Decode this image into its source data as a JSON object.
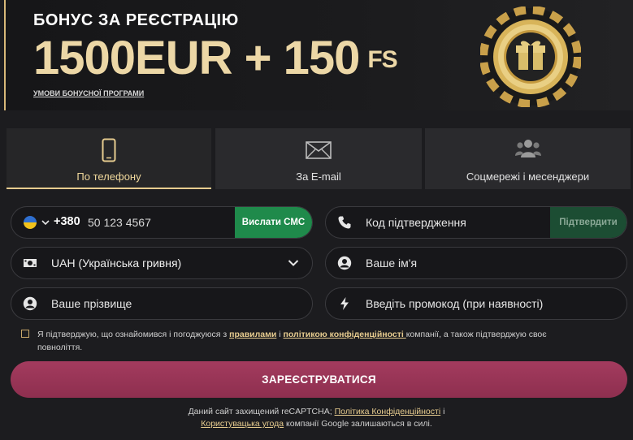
{
  "banner": {
    "title": "БОНУС ЗА РЕЄСТРАЦІЮ",
    "amount": "1500EUR + 150",
    "amount_suffix": "FS",
    "terms_link": "УМОВИ БОНУСНОЇ ПРОГРАМИ"
  },
  "tabs": [
    {
      "label": "По телефону",
      "icon": "phone-icon",
      "active": true
    },
    {
      "label": "За E-mail",
      "icon": "envelope-icon",
      "active": false
    },
    {
      "label": "Соцмережі і месенджери",
      "icon": "users-icon",
      "active": false
    }
  ],
  "form": {
    "phone": {
      "country_flag": "flag-ukraine-icon",
      "code": "+380",
      "placeholder": "50 123 4567",
      "send_sms_label": "Вислати СМС"
    },
    "confirm_code": {
      "placeholder": "Код підтвердження",
      "confirm_label": "Підтвердити"
    },
    "currency": {
      "value": "UAH (Українська гривня)"
    },
    "first_name": {
      "placeholder": "Ваше ім'я"
    },
    "last_name": {
      "placeholder": "Ваше прізвище"
    },
    "promo": {
      "placeholder": "Введіть промокод (при наявності)"
    }
  },
  "consent": {
    "text_before": "Я підтверджую, що ознайомився і погоджуюся з ",
    "rules_link": "правилами",
    "and": " і ",
    "policy_link": "політикою конфіденційності ",
    "text_after": "компанії, а також підтверджую своє повноліття."
  },
  "register_label": "ЗАРЕЄСТРУВАТИСЯ",
  "recaptcha": {
    "text1": "Даний сайт захищений reCAPTCHA; ",
    "privacy_link": "Політика Конфіденційності",
    "text2": " і",
    "terms_link": "Користувацька угода",
    "text3": " компанії Google залишаються в силі."
  },
  "colors": {
    "accent_gold": "#e7cc8f",
    "green": "#1f8a4b",
    "register": "#9a3658",
    "bg": "#1c1c1f"
  }
}
